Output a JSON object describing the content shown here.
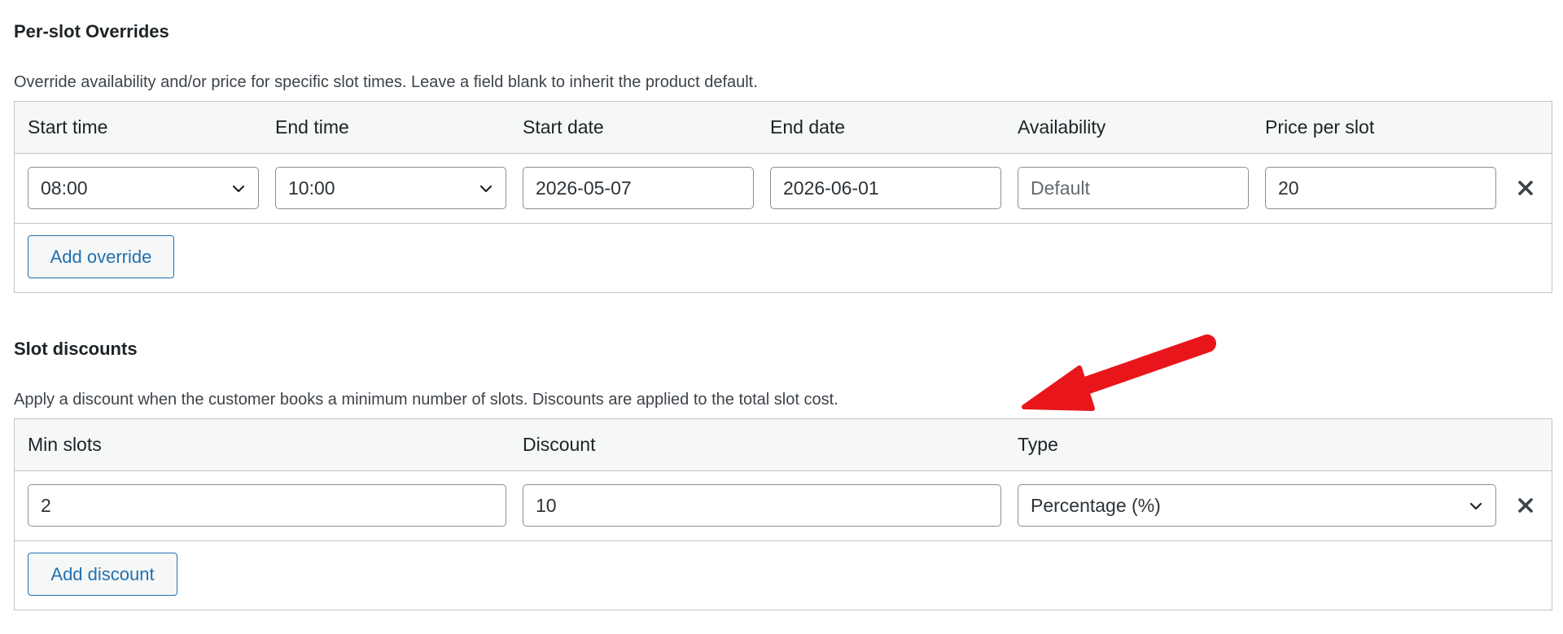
{
  "overrides": {
    "title": "Per-slot Overrides",
    "description": "Override availability and/or price for specific slot times. Leave a field blank to inherit the product default.",
    "columns": {
      "start_time": "Start time",
      "end_time": "End time",
      "start_date": "Start date",
      "end_date": "End date",
      "availability": "Availability",
      "price": "Price per slot"
    },
    "row": {
      "start_time": "08:00",
      "end_time": "10:00",
      "start_date": "2026-05-07",
      "end_date": "2026-06-01",
      "availability_placeholder": "Default",
      "availability_value": "",
      "price": "20"
    },
    "add_button": "Add override"
  },
  "discounts": {
    "title": "Slot discounts",
    "description": "Apply a discount when the customer books a minimum number of slots. Discounts are applied to the total slot cost.",
    "columns": {
      "min_slots": "Min slots",
      "discount": "Discount",
      "type": "Type"
    },
    "row": {
      "min_slots": "2",
      "discount": "10",
      "type": "Percentage (%)"
    },
    "add_button": "Add discount"
  },
  "annotation": {
    "arrow_color": "#e8161b",
    "icon": "red-arrow-icon"
  },
  "icons": {
    "remove": "close-icon",
    "dropdown": "chevron-down-icon"
  }
}
